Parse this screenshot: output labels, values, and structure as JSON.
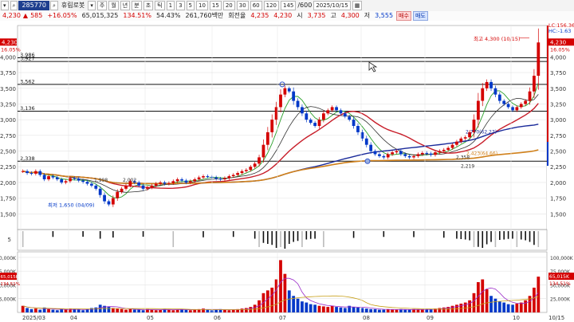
{
  "toolbar": {
    "code": "285770",
    "name": "휴림로봇",
    "periods": [
      "주",
      "월",
      "년",
      "분",
      "초",
      "틱"
    ],
    "minutes": [
      "1",
      "3",
      "5",
      "10",
      "15",
      "20",
      "30",
      "60",
      "120"
    ],
    "count": "145",
    "count_total": "/600",
    "date": "2025/10/15"
  },
  "quote": {
    "price": "4,230",
    "change": "585",
    "change_pct": "+16.05%",
    "volume": "65,015,325",
    "vol_ratio": "134.51%",
    "turnover_rate": "54.43%",
    "amount": "261,760백만",
    "label_turnover": "회전율",
    "label_open": "시",
    "open": "3,735",
    "label_high": "고",
    "high": "4,300",
    "label_low": "저",
    "low": "3,555",
    "buy_label": "매수",
    "sell_label": "매도",
    "sign_up": "▲",
    "prev_price": "4,235"
  },
  "chart_data": {
    "type": "candlestick",
    "price_axis": {
      "min": 1250,
      "max": 4500,
      "ticks": [
        "4,000",
        "3,750",
        "3,500",
        "3,250",
        "3,000",
        "2,750",
        "2,500",
        "2,250",
        "2,000",
        "1,750",
        "1,500"
      ]
    },
    "current_price_tag": "4,230",
    "current_pct_tag": "16.05%",
    "lc_label": "LC:156.36",
    "hc_label": "HC:-1.63",
    "horizontal_lines": [
      {
        "label": "3,986",
        "value": 3986
      },
      {
        "label": "3,927",
        "value": 3927
      },
      {
        "label": "3,562",
        "value": 3562
      },
      {
        "label": "3,136",
        "value": 3136
      },
      {
        "label": "2,338",
        "value": 2338
      }
    ],
    "annotations": [
      {
        "text": "최고 4,300 (10/15)",
        "value": 4300
      },
      {
        "text": "최저 1,650 (04/09)",
        "value": 1650
      },
      {
        "text": "2,770(62.27)",
        "value": 2770
      },
      {
        "text": "2,423(64.66)",
        "value": 2423
      },
      {
        "text": "2,219",
        "value": 2219
      },
      {
        "text": "2,358",
        "value": 2358
      },
      {
        "text": "1,998",
        "value": 1998
      },
      {
        "text": "2,002",
        "value": 2002
      }
    ],
    "months": [
      "2025/03",
      "04",
      "05",
      "06",
      "07",
      "08",
      "09",
      "10",
      "10/15"
    ],
    "closes": [
      2180,
      2150,
      2140,
      2180,
      2120,
      2050,
      2100,
      2080,
      2050,
      2000,
      2020,
      2070,
      2060,
      2030,
      2010,
      1980,
      1950,
      1900,
      1800,
      1700,
      1650,
      1750,
      1850,
      1900,
      1950,
      2020,
      2000,
      1950,
      1900,
      1920,
      1950,
      1980,
      2000,
      1980,
      1990,
      2020,
      2050,
      2030,
      2000,
      2020,
      2050,
      2080,
      2100,
      2090,
      2080,
      2060,
      2050,
      2070,
      2100,
      2120,
      2150,
      2180,
      2200,
      2250,
      2300,
      2400,
      2600,
      2800,
      3000,
      3200,
      3400,
      3500,
      3450,
      3300,
      3200,
      3100,
      3000,
      2950,
      2900,
      3000,
      3100,
      3150,
      3200,
      3150,
      3100,
      3050,
      3000,
      2900,
      2800,
      2700,
      2600,
      2500,
      2450,
      2420,
      2400,
      2450,
      2480,
      2500,
      2450,
      2420,
      2400,
      2420,
      2450,
      2470,
      2460,
      2440,
      2480,
      2500,
      2520,
      2550,
      2600,
      2650,
      2700,
      2720,
      2800,
      3000,
      3300,
      3500,
      3600,
      3500,
      3400,
      3300,
      3250,
      3200,
      3150,
      3200,
      3250,
      3300,
      3450,
      3700,
      4230
    ],
    "vol_axis": {
      "ticks": [
        "100,000K",
        "75,000K",
        "50,000K",
        "25,000K"
      ]
    },
    "volume_tag": "65,015K",
    "volume_pct_tag": "134.51%",
    "volumes": [
      12,
      8,
      6,
      7,
      5,
      9,
      6,
      5,
      4,
      6,
      5,
      7,
      6,
      5,
      4,
      6,
      8,
      9,
      14,
      12,
      10,
      8,
      7,
      6,
      5,
      6,
      5,
      5,
      4,
      6,
      5,
      4,
      5,
      6,
      5,
      4,
      5,
      6,
      5,
      4,
      5,
      6,
      7,
      5,
      4,
      5,
      6,
      5,
      4,
      5,
      6,
      7,
      8,
      10,
      14,
      22,
      35,
      40,
      45,
      60,
      95,
      70,
      40,
      30,
      25,
      20,
      18,
      15,
      14,
      12,
      11,
      10,
      12,
      10,
      9,
      8,
      12,
      10,
      9,
      8,
      7,
      6,
      6,
      5,
      5,
      6,
      5,
      5,
      6,
      5,
      5,
      6,
      5,
      5,
      6,
      6,
      7,
      8,
      9,
      10,
      12,
      14,
      16,
      18,
      22,
      35,
      55,
      60,
      42,
      30,
      25,
      20,
      18,
      15,
      14,
      16,
      18,
      22,
      30,
      45,
      65
    ],
    "vol_max": 110,
    "signal_label": "5"
  }
}
